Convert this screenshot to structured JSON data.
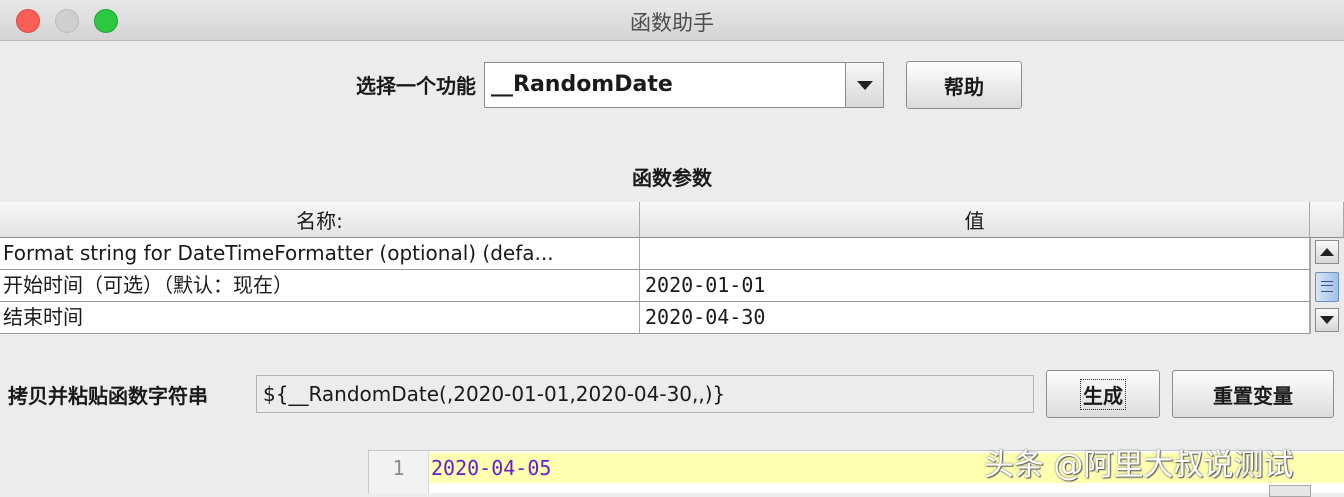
{
  "window": {
    "title": "函数助手"
  },
  "function_select": {
    "label": "选择一个功能",
    "value": "__RandomDate",
    "help_label": "帮助"
  },
  "params": {
    "section_title": "函数参数",
    "headers": {
      "name": "名称:",
      "value": "值"
    },
    "rows": [
      {
        "name": "Format string for DateTimeFormatter (optional) (defa...",
        "value": ""
      },
      {
        "name": "开始时间（可选）（默认：现在）",
        "value": "2020-01-01"
      },
      {
        "name": "结束时间",
        "value": "2020-04-30"
      }
    ]
  },
  "copy": {
    "label": "拷贝并粘贴函数字符串",
    "value": "${__RandomDate(,2020-01-01,2020-04-30,,)}",
    "generate_label": "生成",
    "reset_label": "重置变量"
  },
  "result": {
    "line_number": "1",
    "text": "2020-04-05"
  },
  "watermark": "头条 @阿里大叔说测试"
}
